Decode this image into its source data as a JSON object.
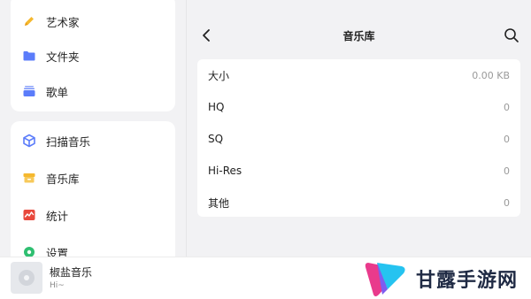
{
  "sidebar": {
    "top_items": [
      {
        "label": "艺术家",
        "icon": "pencil-icon"
      },
      {
        "label": "文件夹",
        "icon": "folder-icon"
      },
      {
        "label": "歌单",
        "icon": "playlist-icon"
      }
    ],
    "bottom_items": [
      {
        "label": "扫描音乐",
        "icon": "scan-icon"
      },
      {
        "label": "音乐库",
        "icon": "music-library-icon"
      },
      {
        "label": "统计",
        "icon": "chart-icon"
      },
      {
        "label": "设置",
        "icon": "settings-icon"
      }
    ]
  },
  "header": {
    "title": "音乐库"
  },
  "stats": [
    {
      "label": "大小",
      "value": "0.00 KB"
    },
    {
      "label": "HQ",
      "value": "0"
    },
    {
      "label": "SQ",
      "value": "0"
    },
    {
      "label": "Hi-Res",
      "value": "0"
    },
    {
      "label": "其他",
      "value": "0"
    }
  ],
  "player": {
    "title": "椒盐音乐",
    "subtitle": "Hi~"
  },
  "watermark": {
    "text": "甘露手游网"
  },
  "colors": {
    "accent_blue": "#5b7cfa",
    "pencil_yellow": "#f5b82e",
    "chart_red": "#e8483c"
  }
}
